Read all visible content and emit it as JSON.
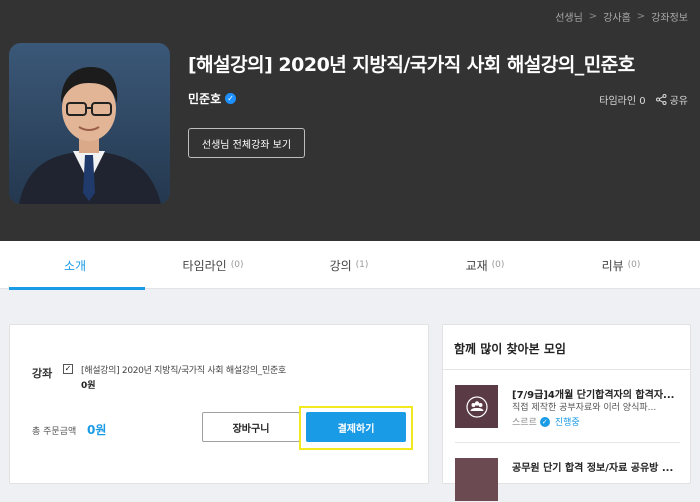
{
  "breadcrumb": [
    "선생님",
    "강사홈",
    "강좌정보"
  ],
  "course": {
    "title": "[해설강의] 2020년 지방직/국가직 사회 해설강의_민준호",
    "teacher": "민준호",
    "timeline_label": "타임라인 0",
    "share_label": "공유",
    "all_courses_button": "선생님 전체강좌 보기"
  },
  "tabs": [
    {
      "label": "소개",
      "count": ""
    },
    {
      "label": "타임라인",
      "count": "(0)"
    },
    {
      "label": "강의",
      "count": "(1)"
    },
    {
      "label": "교재",
      "count": "(0)"
    },
    {
      "label": "리뷰",
      "count": "(0)"
    }
  ],
  "order": {
    "course_label": "강좌",
    "course_checked": true,
    "course_name": "[해설강의] 2020년 지방직/국가직 사회 해설강의_민준호",
    "course_price": "0원",
    "total_label": "총 주문금액",
    "total_value": "0원",
    "cart_button": "장바구니",
    "pay_button": "결제하기"
  },
  "sidebar": {
    "title": "함께 많이 찾아본 모임",
    "items": [
      {
        "title": "[7/9급]4개월 단기합격자의 합격자...",
        "desc": "직접 제작한 공부자료와 이러 양식파...",
        "group": "스르르",
        "author": "진행중"
      },
      {
        "title": "공무원 단기 합격 정보/자료 공유방 ...",
        "desc": "",
        "group": "",
        "author": ""
      }
    ]
  },
  "colors": {
    "accent": "#1a9be6",
    "hero_bg": "#333333",
    "highlight": "#f2ea1f"
  }
}
